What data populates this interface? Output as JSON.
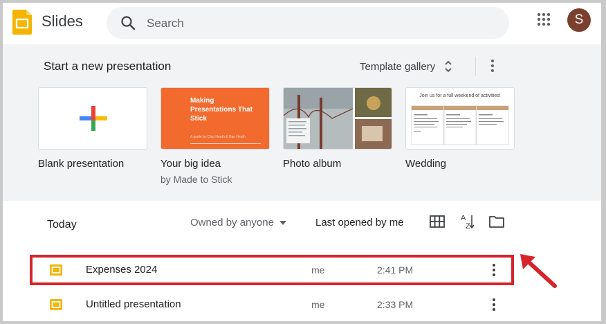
{
  "header": {
    "app_name": "Slides",
    "search_placeholder": "Search",
    "avatar_initial": "S"
  },
  "templates": {
    "section_title": "Start a new presentation",
    "gallery_label": "Template gallery",
    "items": [
      {
        "label": "Blank presentation",
        "sub": ""
      },
      {
        "label": "Your big idea",
        "sub": "by Made to Stick",
        "thumb_title": "Making Presentations That Stick",
        "thumb_sub": "A guide by Chip Heath & Dan Heath"
      },
      {
        "label": "Photo album",
        "sub": ""
      },
      {
        "label": "Wedding",
        "sub": "",
        "thumb_title": "Join us for a full weekend of activities!"
      }
    ]
  },
  "list": {
    "heading": "Today",
    "owner_filter": "Owned by anyone",
    "sort_label": "Last opened by me",
    "files": [
      {
        "name": "Expenses 2024",
        "owner": "me",
        "time": "2:41 PM"
      },
      {
        "name": "Untitled presentation",
        "owner": "me",
        "time": "2:33 PM"
      }
    ]
  },
  "colors": {
    "brand_yellow": "#f4b400",
    "highlight_red": "#d7242b",
    "template_bg": "#f1f3f4"
  }
}
